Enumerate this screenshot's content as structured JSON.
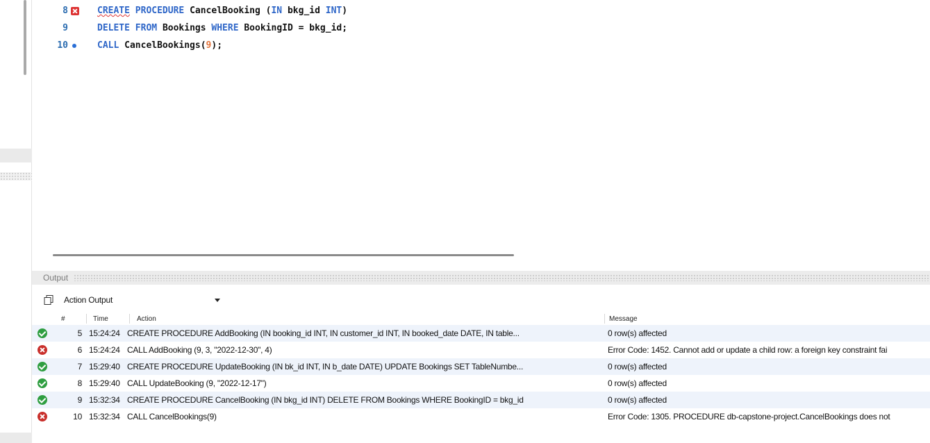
{
  "editor": {
    "lines": [
      {
        "number": "8",
        "marker": "error"
      },
      {
        "number": "9",
        "marker": "none"
      },
      {
        "number": "10",
        "marker": "dot"
      }
    ],
    "line8": {
      "kw1": "CREATE",
      "kw2": "PROCEDURE",
      "name": "CancelBooking",
      "paren": "(",
      "kw3": "IN",
      "param": "bkg_id",
      "kw4": "INT",
      "close": ")"
    },
    "line9": {
      "kw1": "DELETE",
      "kw2": "FROM",
      "table": "Bookings",
      "kw3": "WHERE",
      "cond": "BookingID = bkg_id;"
    },
    "line10": {
      "kw1": "CALL",
      "call": "CancelBookings(",
      "arg": "9",
      "end": ");"
    }
  },
  "output": {
    "title": "Output",
    "selector": "Action Output",
    "columns": {
      "num": "#",
      "time": "Time",
      "action": "Action",
      "message": "Message"
    },
    "rows": [
      {
        "status": "ok",
        "num": "5",
        "time": "15:24:24",
        "action": "CREATE PROCEDURE AddBooking (IN booking_id INT, IN customer_id INT, IN booked_date DATE, IN table...",
        "message": "0 row(s) affected"
      },
      {
        "status": "error",
        "num": "6",
        "time": "15:24:24",
        "action": "CALL AddBooking (9, 3, \"2022-12-30\", 4)",
        "message": "Error Code: 1452. Cannot add or update a child row: a foreign key constraint fai"
      },
      {
        "status": "ok",
        "num": "7",
        "time": "15:29:40",
        "action": "CREATE PROCEDURE UpdateBooking (IN bk_id INT, IN b_date DATE) UPDATE Bookings SET TableNumbe...",
        "message": "0 row(s) affected"
      },
      {
        "status": "ok",
        "num": "8",
        "time": "15:29:40",
        "action": "CALL UpdateBooking (9, \"2022-12-17\")",
        "message": "0 row(s) affected"
      },
      {
        "status": "ok",
        "num": "9",
        "time": "15:32:34",
        "action": "CREATE PROCEDURE CancelBooking (IN bkg_id INT) DELETE FROM Bookings WHERE BookingID = bkg_id",
        "message": "0 row(s) affected"
      },
      {
        "status": "error",
        "num": "10",
        "time": "15:32:34",
        "action": "CALL CancelBookings(9)",
        "message": "Error Code: 1305. PROCEDURE db-capstone-project.CancelBookings does not"
      }
    ]
  },
  "colors": {
    "keyword": "#2e66c8",
    "number": "#e4743b",
    "ok": "#2f9e41",
    "error": "#c9302c",
    "line_number": "#2b6cb0"
  }
}
